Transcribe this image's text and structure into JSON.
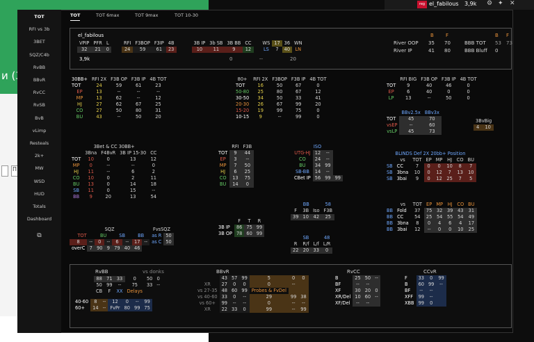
{
  "bg": {
    "headline": "и (3",
    "btn1": "",
    "btn2": "П"
  },
  "topbar": {
    "tag": "reg",
    "user": "el_fabilous",
    "value": "3,9k",
    "icons": [
      "gear-icon",
      "pin-icon",
      "close-icon"
    ]
  },
  "sidebar": [
    "TOT",
    "RFI vs 3b",
    "3BET",
    "SQZ/C4b",
    "RvBB",
    "BBvR",
    "RvCC",
    "RvSB",
    "BvB",
    "vLimp",
    "Resteals",
    "2k+",
    "MW",
    "WSD",
    "HUD",
    "Totals",
    "Dashboard"
  ],
  "tabs": [
    "TOT",
    "TOT 6max",
    "TOT 9max",
    "TOT 10-30"
  ],
  "summary": {
    "name": "el_fabilous",
    "h": [
      "VPIP",
      "PFR",
      "L",
      "RFI",
      "F3BOP",
      "F3IP",
      "4B",
      "3B IP",
      "3b SB",
      "3B BB",
      "CC",
      "WS",
      "17",
      "36",
      "WN"
    ],
    "r1": [
      "32",
      "21",
      "0",
      "24",
      "59",
      "61",
      "23",
      "10",
      "11",
      "9",
      "12",
      "LS",
      "7",
      "40",
      "LN"
    ],
    "r2": [
      "3,9k",
      "0",
      "--",
      "20"
    ],
    "river": {
      "B": "B",
      "F": "F",
      "oop": "River OOP",
      "ip": "River IP",
      "oopB": "35",
      "oopF": "70",
      "ipB": "41",
      "ipF": "80",
      "bbbtot": "BBB TOT",
      "bbbbluff": "BBB Bluff",
      "t1": "53",
      "t2": "73",
      "bl1": "0"
    }
  },
  "t30bb": {
    "h": [
      "30BB+",
      "RFI 2X",
      "F3B OP",
      "F3B IP",
      "4B TOT"
    ],
    "rows": [
      [
        "TOT",
        "24",
        "59",
        "61",
        "23"
      ],
      [
        "EP",
        "13",
        "--",
        "--",
        "--"
      ],
      [
        "MP",
        "13",
        "62",
        "--",
        "12"
      ],
      [
        "HJ",
        "27",
        "62",
        "67",
        "25"
      ],
      [
        "CO",
        "27",
        "50",
        "80",
        "31"
      ],
      [
        "BU",
        "43",
        "--",
        "50",
        "20"
      ]
    ]
  },
  "t80": {
    "h": [
      "80+",
      "RFI 2X",
      "F3BOP",
      "F3B IP",
      "4B TOT"
    ],
    "rows": [
      [
        "TOT",
        "16",
        "50",
        "67",
        "0"
      ],
      [
        "50-80",
        "25",
        "80",
        "67",
        "12"
      ],
      [
        "30-50",
        "34",
        "50",
        "33",
        "41"
      ],
      [
        "20-30",
        "26",
        "67",
        "99",
        "20"
      ],
      [
        "15-20",
        "19",
        "99",
        "75",
        "0"
      ],
      [
        "10-15",
        "9",
        "--",
        "99",
        "0"
      ]
    ]
  },
  "tbig": {
    "h": [
      "",
      "RFI BIG",
      "F3B OP",
      "F3B IP",
      "4B TOT"
    ],
    "rows": [
      [
        "TOT",
        "9",
        "40",
        "46",
        "0"
      ],
      [
        "EP",
        "6",
        "40",
        "0",
        "0"
      ],
      [
        "LP",
        "13",
        "--",
        "50",
        "0"
      ]
    ],
    "bbv": "BBv2.5x",
    "bbv3": "BBv3x",
    "r1": [
      "TOT",
      "45",
      "70"
    ],
    "r2": [
      "vsEP",
      "--",
      "60"
    ],
    "r3": [
      "vsLP",
      "45",
      "73"
    ],
    "big3": "3BvBig",
    "big3v": [
      "4",
      "10"
    ]
  },
  "t3bet": {
    "title": "3Bet & CC 30BB+",
    "h": [
      "",
      "3Bna",
      "F4BvR",
      "3B IP 15-30",
      "CC"
    ],
    "rows": [
      [
        "TOT",
        "10",
        "0",
        "13",
        "12"
      ],
      [
        "MP",
        "0",
        "--",
        "--",
        "0"
      ],
      [
        "HJ",
        "11",
        "--",
        "6",
        "2"
      ],
      [
        "CO",
        "10",
        "0",
        "2",
        "11"
      ],
      [
        "BU",
        "13",
        "0",
        "14",
        "18"
      ],
      [
        "SB",
        "11",
        "0",
        "15",
        "--"
      ],
      [
        "BB",
        "9",
        "20",
        "13",
        "54"
      ]
    ]
  },
  "tpos": {
    "h": [
      "",
      "RFI",
      "F3B"
    ],
    "rows": [
      [
        "TOT",
        "9",
        "44"
      ],
      [
        "EP",
        "3",
        "--"
      ],
      [
        "MP",
        "7",
        "50"
      ],
      [
        "HJ",
        "6",
        "25"
      ],
      [
        "CO",
        "13",
        "75"
      ],
      [
        "BU",
        "14",
        "0"
      ]
    ]
  },
  "tiso": {
    "title": "ISO",
    "rows": [
      [
        "UTG-HJ",
        "12",
        "--"
      ],
      [
        "CO",
        "24",
        "--"
      ],
      [
        "BU",
        "34",
        "99"
      ],
      [
        "SB-BB",
        "14",
        "--"
      ],
      [
        "CBet IP",
        "56",
        "99",
        "99"
      ]
    ]
  },
  "tblinds": {
    "title": "BLINDS  Def  2X  20bb+  Position",
    "h": [
      "",
      "vs",
      "TOT",
      "EP",
      "MP",
      "HJ",
      "CO",
      "BU"
    ],
    "sb": "SB",
    "rows": [
      [
        "CC",
        "7",
        "0",
        "0",
        "10",
        "8",
        "7"
      ],
      [
        "3bna",
        "10",
        "0",
        "12",
        "7",
        "13",
        "10"
      ],
      [
        "3bai",
        "9",
        "0",
        "12",
        "25",
        "7",
        "5"
      ]
    ]
  },
  "tbb": {
    "h": [
      "",
      "vs",
      "TOT",
      "EP",
      "MP",
      "HJ",
      "CO",
      "BU"
    ],
    "bb": "BB",
    "rows": [
      [
        "Fold",
        "37",
        "75",
        "32",
        "39",
        "43",
        "31"
      ],
      [
        "CC",
        "54",
        "25",
        "54",
        "55",
        "54",
        "49"
      ],
      [
        "3bna",
        "8",
        "0",
        "4",
        "6",
        "4",
        "17"
      ],
      [
        "3bai",
        "12",
        "--",
        "0",
        "0",
        "10",
        "25"
      ]
    ]
  },
  "tsqz": {
    "title": "SQZ",
    "fv": "FvsSQZ",
    "h": [
      "TOT",
      "BU",
      "SB",
      "BB"
    ],
    "asR": "as R",
    "asC": "as C",
    "asRv": "50",
    "asCv": "50",
    "r1": [
      "8",
      "--",
      "0",
      "--",
      "6",
      "--",
      "17",
      "--"
    ],
    "r2": [
      "overC",
      "7",
      "90",
      "9",
      "79",
      "40",
      "46"
    ]
  },
  "t3bip": {
    "h": [
      "",
      "F",
      "T",
      "R"
    ],
    "rows": [
      [
        "3B IP",
        "86",
        "75",
        "99"
      ],
      [
        "3B OP",
        "78",
        "60",
        "99"
      ]
    ]
  },
  "tbb58": {
    "h": [
      "BB",
      "58"
    ],
    "h2": [
      "F",
      "3B",
      "Iso",
      "F3B"
    ],
    "r": [
      "39",
      "10",
      "42",
      "25"
    ]
  },
  "tsb48": {
    "h": [
      "SB",
      "48"
    ],
    "h2": [
      "R",
      "R/f",
      "L/f",
      "L/R"
    ],
    "r": [
      "22",
      "20",
      "33",
      "0"
    ]
  },
  "bottom": {
    "rvbb": "RvBB",
    "vsd": "vs donks",
    "bbvr": "BBvR",
    "rvcc": "RvCC",
    "ccvr": "CCvR",
    "rvbbrows": [
      [
        "88",
        "71",
        "33",
        "0",
        "50",
        "0"
      ],
      [
        "50",
        "99",
        "--",
        "75",
        "33",
        "--"
      ]
    ],
    "rvbb2h": [
      "CB",
      "F",
      "XX",
      "Delays"
    ],
    "rvbb2": [
      [
        "40-60",
        "8",
        "--",
        "12",
        "0",
        "--",
        "99"
      ],
      [
        "60+",
        "14",
        "--",
        "FvPr",
        "80",
        "99",
        "75"
      ]
    ],
    "bbvrrows": [
      [
        "",
        "43",
        "57",
        "99",
        "5",
        "0",
        "0"
      ],
      [
        "XR",
        "27",
        "0",
        "0",
        "0",
        "--",
        ""
      ],
      [
        "vs 27-35",
        "48",
        "60",
        "99",
        "Probes & FvDel",
        "",
        ""
      ],
      [
        "vs 40-60",
        "33",
        "0",
        "--",
        "29",
        "99",
        "38"
      ],
      [
        "vs 60+",
        "99",
        "--",
        "--",
        "0",
        "--",
        "--"
      ],
      [
        "XR",
        "22",
        "33",
        "0",
        "99",
        "--",
        "99"
      ]
    ],
    "rvccrows": [
      [
        "B",
        "25",
        "50",
        "--"
      ],
      [
        "BF",
        "--",
        "--",
        ""
      ],
      [
        "XF",
        "30",
        "20",
        "0"
      ],
      [
        "XR/Del",
        "10",
        "60",
        "--"
      ],
      [
        "XF/Del",
        "--",
        "--",
        ""
      ]
    ],
    "ccvrrows": [
      [
        "F",
        "33",
        "0",
        "99"
      ],
      [
        "B",
        "60",
        "99",
        "--"
      ],
      [
        "BF",
        "--",
        "--",
        ""
      ],
      [
        "XFF",
        "99",
        "--",
        ""
      ],
      [
        "XBB",
        "99",
        "0",
        ""
      ]
    ]
  }
}
